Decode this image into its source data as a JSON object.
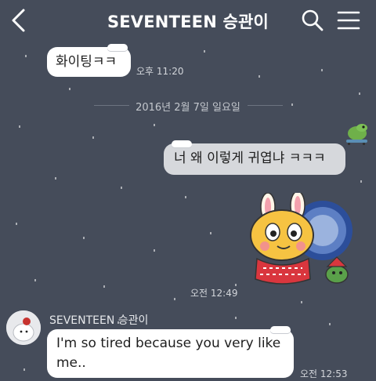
{
  "header": {
    "title": "SEVENTEEN 승관이",
    "back_icon": "chevron-left-icon",
    "search_icon": "search-icon",
    "menu_icon": "hamburger-menu-icon"
  },
  "messages": {
    "first_incoming": {
      "text": "화이팅ㅋㅋ",
      "time": "오후 11:20"
    },
    "date_divider": "2016년 2월 7일 일요일",
    "outgoing": {
      "text": "너 왜 이렇게 귀엽냐 ㅋㅋㅋ",
      "sticker_time": "오전 12:49"
    },
    "last_incoming": {
      "sender": "SEVENTEEN 승관이",
      "text_line1": "I'm so tired because you very like",
      "text_line2": "me..",
      "time": "오전 12:53"
    }
  },
  "stickers": {
    "outgoing_small": "crocodile-sticker",
    "outgoing_large": "rabbit-sticker"
  },
  "colors": {
    "background": "#454c5a",
    "bubble_incoming": "#ffffff",
    "bubble_outgoing": "#d6d8dc",
    "timestamp": "#d2d5da"
  }
}
